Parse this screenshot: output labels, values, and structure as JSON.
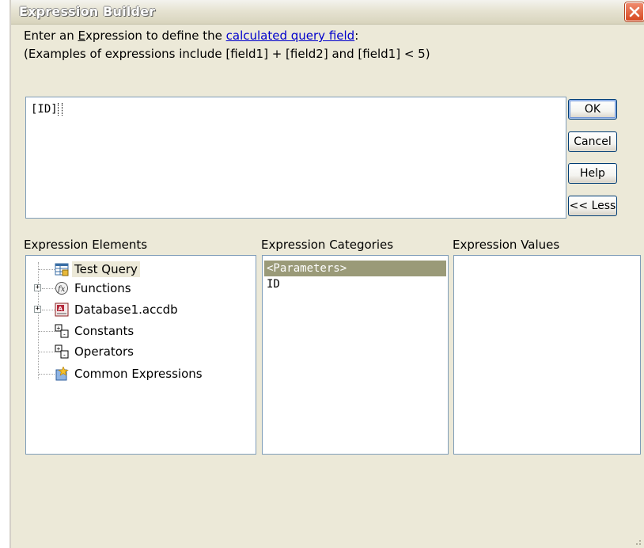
{
  "window": {
    "title": "Expression Builder",
    "close_icon": "close-icon",
    "accent_color": "#e35a2f"
  },
  "prompt": {
    "line1_before": "Enter an ",
    "line1_accel": "E",
    "line1_after": "xpression to define the ",
    "line1_link": "calculated query field",
    "line1_end": ":",
    "line2": "(Examples of expressions include [field1] + [field2] and [field1] < 5)"
  },
  "expression": {
    "value": "[ID]"
  },
  "buttons": {
    "ok": "OK",
    "cancel": "Cancel",
    "help": "Help",
    "less": "<< Less"
  },
  "columns": {
    "elements": "Expression Elements",
    "categories": "Expression Categories",
    "values": "Expression Values"
  },
  "elements_tree": [
    {
      "label": "Test Query",
      "icon": "query-icon",
      "selected": true,
      "expandable": false
    },
    {
      "label": "Functions",
      "icon": "functions-icon",
      "selected": false,
      "expandable": true
    },
    {
      "label": "Database1.accdb",
      "icon": "database-icon",
      "selected": false,
      "expandable": true
    },
    {
      "label": "Constants",
      "icon": "constants-icon",
      "selected": false,
      "expandable": false
    },
    {
      "label": "Operators",
      "icon": "operators-icon",
      "selected": false,
      "expandable": false
    },
    {
      "label": "Common Expressions",
      "icon": "common-expressions-icon",
      "selected": false,
      "expandable": false
    }
  ],
  "categories_list": [
    {
      "label": "<Parameters>",
      "selected": true
    },
    {
      "label": "ID",
      "selected": false
    }
  ],
  "values_list": []
}
